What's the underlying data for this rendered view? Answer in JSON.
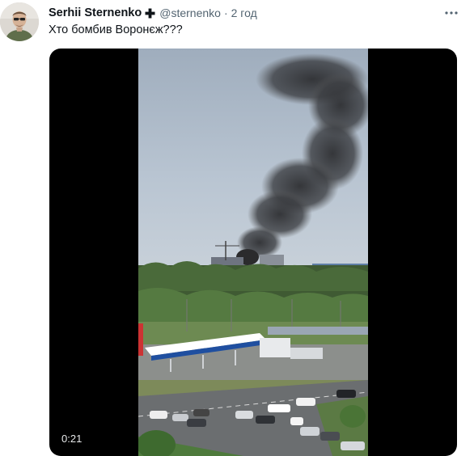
{
  "tweet": {
    "author_name": "Serhii Sternenko",
    "handle": "@sternenko",
    "separator": "·",
    "time": "2 год",
    "text": "Хто бомбив Воронєж???"
  },
  "media": {
    "duration": "0:21"
  },
  "icons": {
    "verified": "cross-plus-icon",
    "more": "more-dots-icon"
  },
  "colors": {
    "text": "#0f1419",
    "secondary": "#536471",
    "media_bg": "#000000",
    "smoke": "#3a3a3c",
    "sky": "#aab8c8"
  }
}
